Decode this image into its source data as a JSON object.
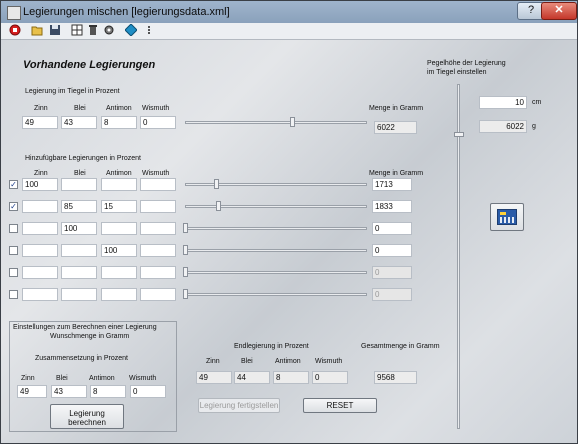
{
  "window": {
    "title": "Legierungen mischen [legierungsdata.xml]",
    "help_label": "?",
    "close_label": "✕"
  },
  "toolbar": {
    "icons": [
      "stop-icon",
      "open-folder-icon",
      "save-icon",
      "grid-icon",
      "delete-icon",
      "settings-icon",
      "diamond-icon",
      "more-icon"
    ]
  },
  "main": {
    "heading": "Vorhandene Legierungen",
    "crucible_label": "Legierung im Tiegel in Prozent",
    "columns": [
      "Zinn",
      "Blei",
      "Antimon",
      "Wismuth"
    ],
    "mass_label": "Menge in Gramm",
    "crucible": {
      "zinn": "49",
      "blei": "43",
      "antimon": "8",
      "wismuth": "0",
      "mass": "6022",
      "slider_fraction": 0.59
    },
    "addable_label": "Hinzufügbare Legierungen in Prozent",
    "addable_columns": [
      "Zinn",
      "Blei",
      "Antimon",
      "Wismuth"
    ],
    "addable_mass_label": "Menge in Gramm",
    "rows": [
      {
        "checked": true,
        "zinn": "100",
        "blei": "",
        "antimon": "",
        "wismuth": "",
        "mass": "1713",
        "slider": 0.17,
        "enabled": true
      },
      {
        "checked": true,
        "zinn": "",
        "blei": "85",
        "antimon": "15",
        "wismuth": "",
        "mass": "1833",
        "slider": 0.18,
        "enabled": true
      },
      {
        "checked": false,
        "zinn": "",
        "blei": "100",
        "antimon": "",
        "wismuth": "",
        "mass": "0",
        "slider": 0.0,
        "enabled": true
      },
      {
        "checked": false,
        "zinn": "",
        "blei": "",
        "antimon": "100",
        "wismuth": "",
        "mass": "0",
        "slider": 0.0,
        "enabled": true
      },
      {
        "checked": false,
        "zinn": "",
        "blei": "",
        "antimon": "",
        "wismuth": "",
        "mass": "0",
        "slider": 0.0,
        "enabled": false
      },
      {
        "checked": false,
        "zinn": "",
        "blei": "",
        "antimon": "",
        "wismuth": "",
        "mass": "0",
        "slider": 0.0,
        "enabled": false
      }
    ]
  },
  "fill": {
    "title_line1": "Pegelhöhe der Legierung",
    "title_line2": "im Tiegel einstellen",
    "height": "10",
    "height_unit": "cm",
    "weight": "6022",
    "weight_unit": "g",
    "slider_fraction": 0.86
  },
  "settings": {
    "line1": "Einstellungen zum Berechnen einer Legierung",
    "line2": "Wunschmenge in Gramm",
    "composition_label": "Zusammensetzung in Prozent",
    "columns": [
      "Zinn",
      "Blei",
      "Antimon",
      "Wismuth"
    ],
    "values": {
      "zinn": "49",
      "blei": "43",
      "antimon": "8",
      "wismuth": "0"
    },
    "calc_line1": "Legierung",
    "calc_line2": "berechnen"
  },
  "result": {
    "label": "Endlegierung in Prozent",
    "columns": [
      "Zinn",
      "Blei",
      "Antimon",
      "Wismuth"
    ],
    "zinn": "49",
    "blei": "44",
    "antimon": "8",
    "wismuth": "0",
    "total_label": "Gesamtmenge in Gramm",
    "total": "9568",
    "finish_label": "Legierung fertigstellen",
    "reset_label": "RESET"
  }
}
